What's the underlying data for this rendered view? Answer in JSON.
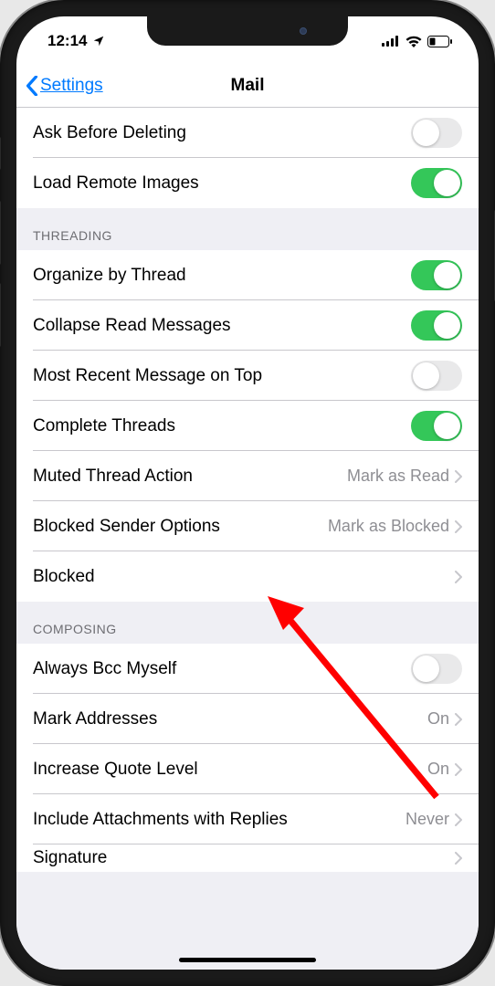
{
  "statusBar": {
    "time": "12:14"
  },
  "nav": {
    "back": "Settings",
    "title": "Mail"
  },
  "group0": {
    "items": [
      {
        "label": "Ask Before Deleting",
        "on": false
      },
      {
        "label": "Load Remote Images",
        "on": true
      }
    ]
  },
  "group1": {
    "header": "THREADING",
    "items": [
      {
        "label": "Organize by Thread",
        "on": true
      },
      {
        "label": "Collapse Read Messages",
        "on": true
      },
      {
        "label": "Most Recent Message on Top",
        "on": false
      },
      {
        "label": "Complete Threads",
        "on": true
      },
      {
        "label": "Muted Thread Action",
        "value": "Mark as Read"
      },
      {
        "label": "Blocked Sender Options",
        "value": "Mark as Blocked"
      },
      {
        "label": "Blocked",
        "value": ""
      }
    ]
  },
  "group2": {
    "header": "COMPOSING",
    "items": [
      {
        "label": "Always Bcc Myself",
        "on": false
      },
      {
        "label": "Mark Addresses",
        "value": "On"
      },
      {
        "label": "Increase Quote Level",
        "value": "On"
      },
      {
        "label": "Include Attachments with Replies",
        "value": "Never"
      },
      {
        "label": "Signature",
        "value": ""
      }
    ]
  }
}
